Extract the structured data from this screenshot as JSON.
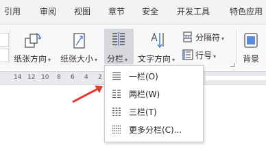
{
  "tabs": [
    "引用",
    "审阅",
    "视图",
    "章节",
    "安全",
    "开发工具",
    "特色应用"
  ],
  "ribbon": {
    "paper_direction": "纸张方向",
    "paper_size": "纸张大小",
    "columns": "分栏",
    "text_direction": "文字方向",
    "separator": "分隔符",
    "line_number": "行号",
    "background": "背景"
  },
  "ruler_numbers": [
    "14",
    "12",
    "10",
    "8",
    "6",
    "4",
    "2"
  ],
  "columns_menu": {
    "items": [
      "一栏(O)",
      "两栏(W)",
      "三栏(T)",
      "更多分栏(C)..."
    ]
  },
  "colors": {
    "accent_blue": "#3c78d8",
    "arrow_red": "#e23a2e",
    "selected_button_bg": "#d5d7db"
  },
  "icons": [
    "page-orientation-icon",
    "page-size-icon",
    "columns-icon",
    "text-direction-icon",
    "separator-icon",
    "line-number-icon",
    "background-icon",
    "red-arrow"
  ]
}
